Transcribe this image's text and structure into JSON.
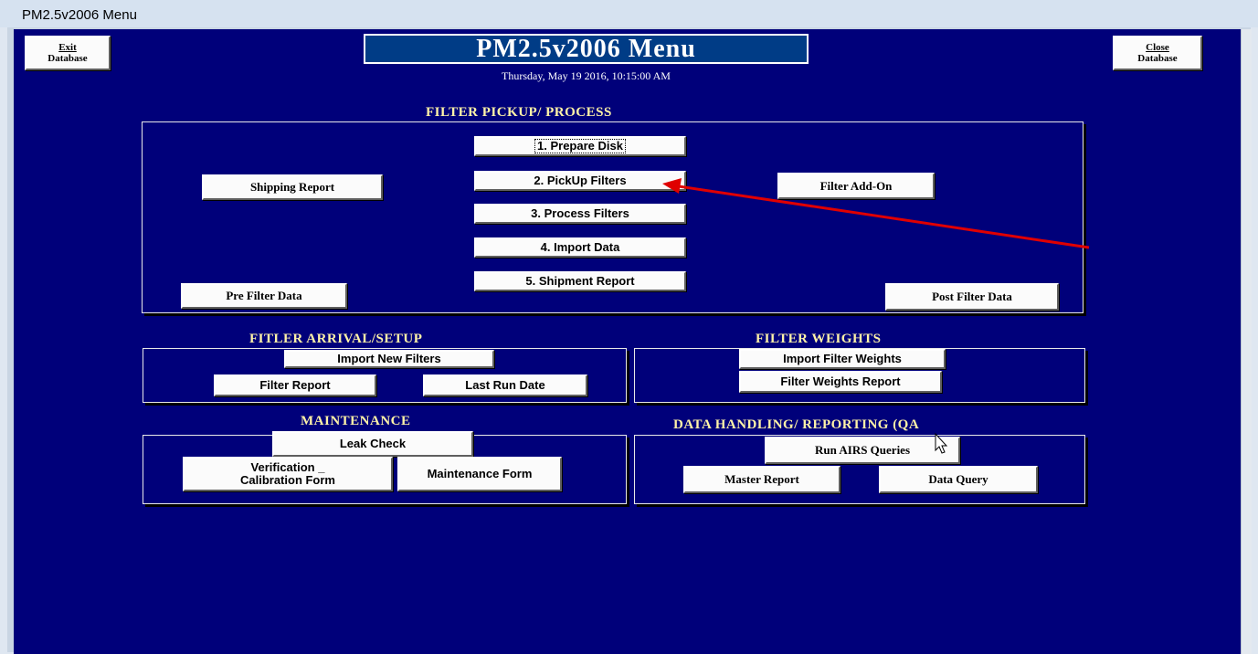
{
  "window": {
    "title": "PM2.5v2006 Menu"
  },
  "header": {
    "title": "PM2.5v2006 Menu",
    "datetime": "Thursday, May 19 2016, 10:15:00 AM",
    "exit_button": [
      "Exit",
      "Database"
    ],
    "close_button": [
      "Close",
      "Database"
    ]
  },
  "filter_pickup": {
    "title": "FILTER PICKUP/ PROCESS",
    "buttons": {
      "prepare_disk": "1. Prepare Disk",
      "pickup_filters": "2. PickUp Filters",
      "process_filters": "3. Process Filters",
      "import_data": "4. Import Data",
      "shipment_report": "5. Shipment Report",
      "shipping_report": "Shipping Report",
      "filter_addon": "Filter Add-On",
      "pre_filter_data": "Pre Filter Data",
      "post_filter_data": "Post Filter Data"
    }
  },
  "arrival": {
    "title": "FITLER ARRIVAL/SETUP",
    "buttons": {
      "import_new_filters": "Import New Filters",
      "filter_report": "Filter Report",
      "last_run_date": "Last Run Date"
    }
  },
  "weights": {
    "title": "FILTER WEIGHTS",
    "buttons": {
      "import_filter_weights": "Import Filter Weights",
      "filter_weights_report": "Filter Weights Report"
    }
  },
  "maintenance": {
    "title": "MAINTENANCE",
    "buttons": {
      "leak_check": "Leak Check",
      "verification_line1": "Verification _",
      "verification_line2": "Calibration Form",
      "maintenance_form": "Maintenance Form"
    }
  },
  "data_handling": {
    "title": "DATA HANDLING/ REPORTING (QA",
    "buttons": {
      "run_airs_queries": "Run AIRS Queries",
      "master_report": "Master Report",
      "data_query": "Data Query"
    }
  },
  "colors": {
    "form_background": "#00007a",
    "section_title": "#fff3a8",
    "annotation_arrow": "#e00000"
  }
}
